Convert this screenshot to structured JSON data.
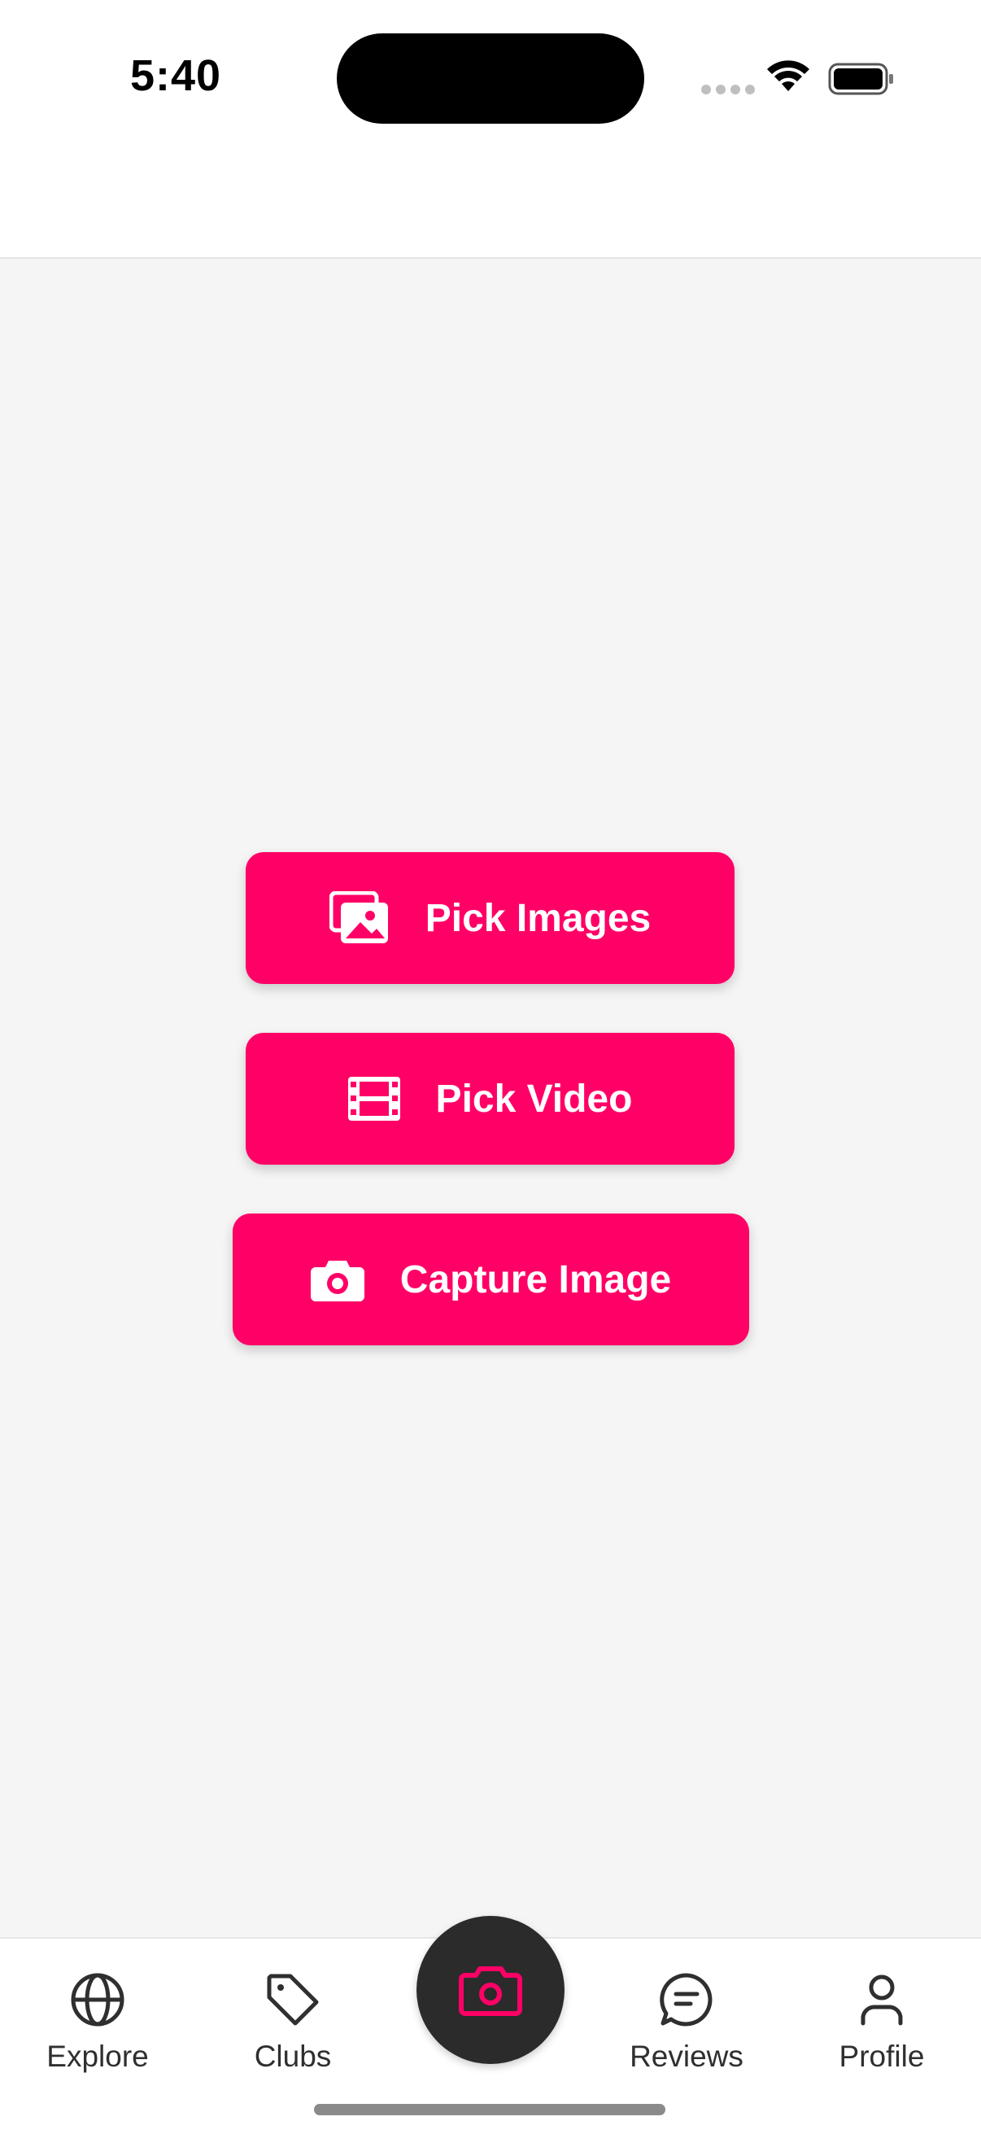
{
  "status_bar": {
    "time": "5:40"
  },
  "actions": {
    "pick_images": {
      "label": "Pick Images",
      "icon": "images-icon"
    },
    "pick_video": {
      "label": "Pick Video",
      "icon": "film-icon"
    },
    "capture_image": {
      "label": "Capture Image",
      "icon": "camera-icon"
    }
  },
  "tab_bar": {
    "items": [
      {
        "label": "Explore",
        "icon": "globe-icon"
      },
      {
        "label": "Clubs",
        "icon": "tag-icon"
      },
      {
        "label": "Reviews",
        "icon": "chat-icon"
      },
      {
        "label": "Profile",
        "icon": "person-icon"
      }
    ],
    "center_button_icon": "camera-icon"
  },
  "colors": {
    "accent": "#ff0066",
    "fab_background": "#2b2b2b",
    "page_background": "#f5f5f5"
  }
}
